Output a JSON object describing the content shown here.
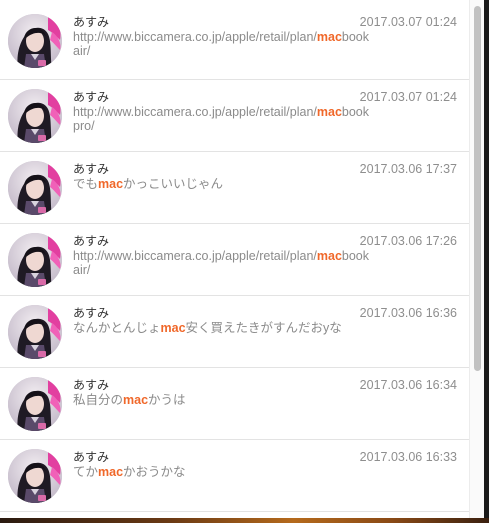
{
  "messages": [
    {
      "sender": "あすみ",
      "timestamp": "2017.03.07 01:24",
      "parts": [
        {
          "text": "http://www.biccamera.co.jp/apple/retail/plan/",
          "hl": false
        },
        {
          "text": "mac",
          "hl": true
        },
        {
          "text": "bookair/",
          "hl": false
        }
      ]
    },
    {
      "sender": "あすみ",
      "timestamp": "2017.03.07 01:24",
      "parts": [
        {
          "text": "http://www.biccamera.co.jp/apple/retail/plan/",
          "hl": false
        },
        {
          "text": "mac",
          "hl": true
        },
        {
          "text": "bookpro/",
          "hl": false
        }
      ]
    },
    {
      "sender": "あすみ",
      "timestamp": "2017.03.06 17:37",
      "parts": [
        {
          "text": "でも",
          "hl": false
        },
        {
          "text": "mac",
          "hl": true
        },
        {
          "text": "かっこいいじゃん",
          "hl": false
        }
      ]
    },
    {
      "sender": "あすみ",
      "timestamp": "2017.03.06 17:26",
      "parts": [
        {
          "text": "http://www.biccamera.co.jp/apple/retail/plan/",
          "hl": false
        },
        {
          "text": "mac",
          "hl": true
        },
        {
          "text": "bookair/",
          "hl": false
        }
      ]
    },
    {
      "sender": "あすみ",
      "timestamp": "2017.03.06 16:36",
      "parts": [
        {
          "text": "なんかとんじょ",
          "hl": false
        },
        {
          "text": "mac",
          "hl": true
        },
        {
          "text": "安く買えたきがすんだおyな",
          "hl": false
        }
      ]
    },
    {
      "sender": "あすみ",
      "timestamp": "2017.03.06 16:34",
      "parts": [
        {
          "text": "私自分の",
          "hl": false
        },
        {
          "text": "mac",
          "hl": true
        },
        {
          "text": "かうは",
          "hl": false
        }
      ]
    },
    {
      "sender": "あすみ",
      "timestamp": "2017.03.06 16:33",
      "parts": [
        {
          "text": "てか",
          "hl": false
        },
        {
          "text": "mac",
          "hl": true
        },
        {
          "text": "かおうかな",
          "hl": false
        }
      ]
    }
  ],
  "colors": {
    "highlight": "#f0682a",
    "body_text": "#8b8b8b",
    "sender_text": "#333333",
    "timestamp_text": "#8e8e8e",
    "divider": "#e3e3e3"
  },
  "icons": {
    "avatar": "user-avatar-photo"
  }
}
